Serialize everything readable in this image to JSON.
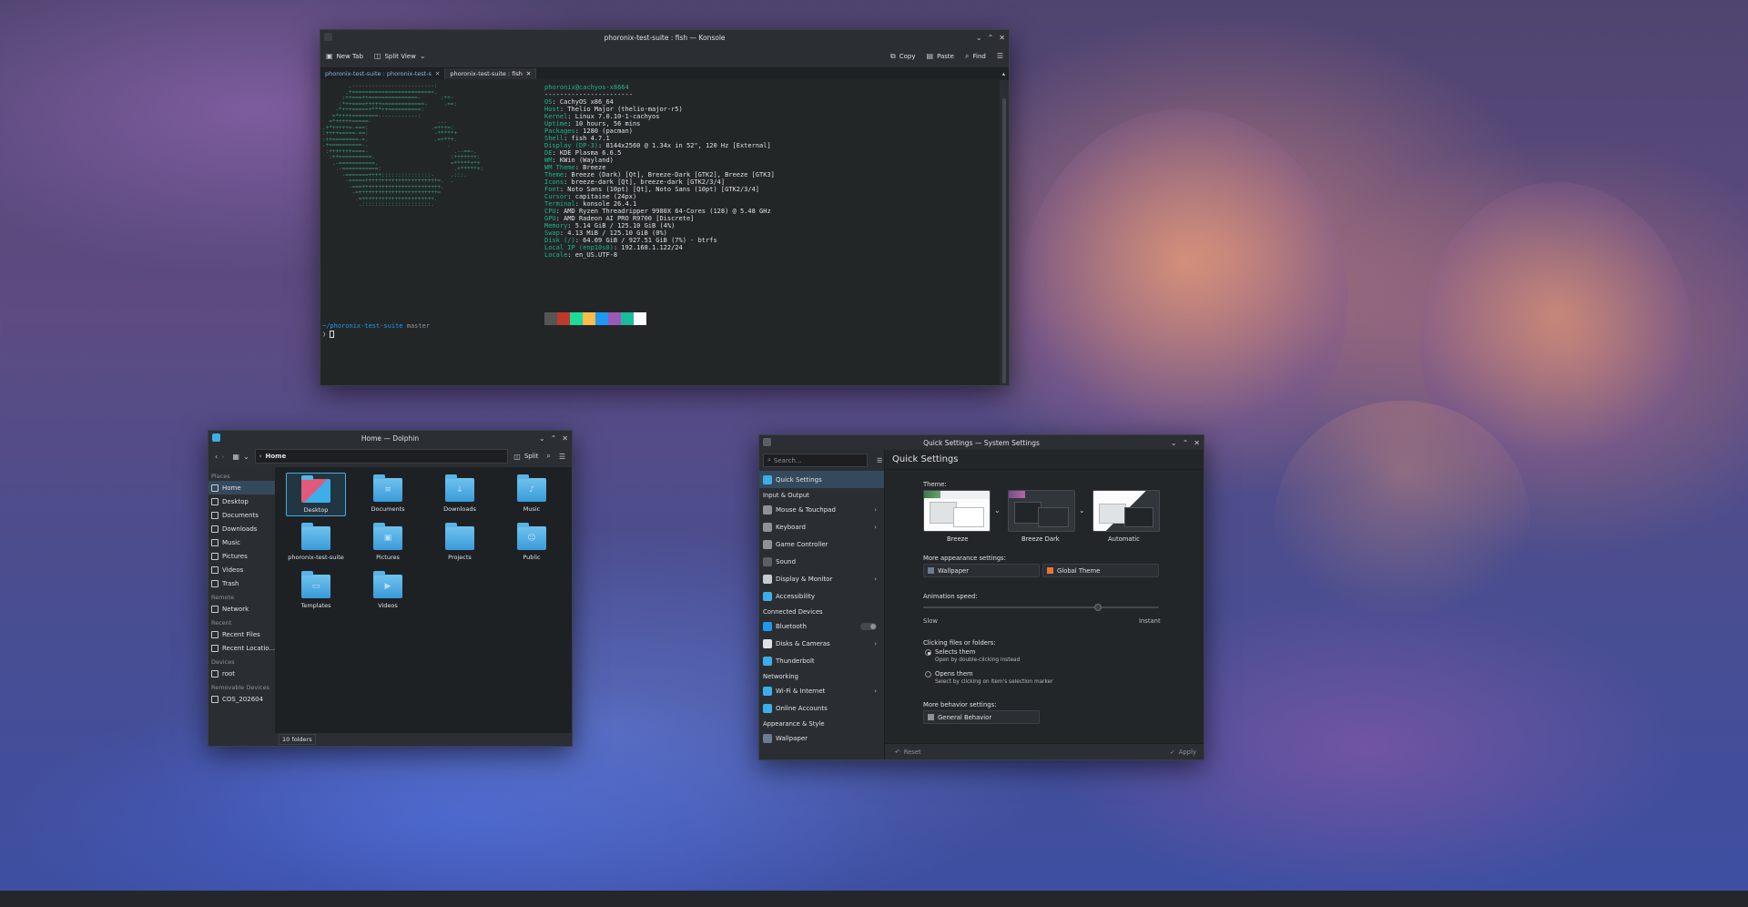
{
  "konsole": {
    "title": "phoronix-test-suite : fish — Konsole",
    "toolbar": {
      "new_tab": "New Tab",
      "split_view": "Split View",
      "copy": "Copy",
      "paste": "Paste",
      "find": "Find"
    },
    "tabs": [
      "phoronix-test-suite : phoronix-test-s",
      "phoronix-test-suite : fish"
    ],
    "user_host": "phoronix@cachyos-x8664",
    "separator": "-----------------------",
    "info": [
      {
        "k": "OS",
        "v": "CachyOS x86_64"
      },
      {
        "k": "Host",
        "v": "Thelio Major (thelio-major-r5)"
      },
      {
        "k": "Kernel",
        "v": "Linux 7.0.10-1-cachyos"
      },
      {
        "k": "Uptime",
        "v": "10 hours, 56 mins"
      },
      {
        "k": "Packages",
        "v": "1280 (pacman)"
      },
      {
        "k": "Shell",
        "v": "fish 4.7.1"
      },
      {
        "k": "Display (DP-3)",
        "v": "8144x2560 @ 1.34x in 52\", 120 Hz [External]"
      },
      {
        "k": "DE",
        "v": "KDE Plasma 6.6.5"
      },
      {
        "k": "WM",
        "v": "KWin (Wayland)"
      },
      {
        "k": "WM Theme",
        "v": "Breeze"
      },
      {
        "k": "Theme",
        "v": "Breeze (Dark) [Qt], Breeze-Dark [GTK2], Breeze [GTK3]"
      },
      {
        "k": "Icons",
        "v": "breeze-dark [Qt], breeze-dark [GTK2/3/4]"
      },
      {
        "k": "Font",
        "v": "Noto Sans (10pt) [Qt], Noto Sans (10pt) [GTK2/3/4]"
      },
      {
        "k": "Cursor",
        "v": "capitaine (24px)"
      },
      {
        "k": "Terminal",
        "v": "konsole 26.4.1"
      },
      {
        "k": "CPU",
        "v": "AMD Ryzen Threadripper 9980X 64-Cores (128) @ 5.48 GHz"
      },
      {
        "k": "GPU",
        "v": "AMD Radeon AI PRO R9700 [Discrete]"
      },
      {
        "k": "Memory",
        "v": "5.14 GiB / 125.10 GiB (4%)"
      },
      {
        "k": "Swap",
        "v": "4.13 MiB / 125.10 GiB (0%)"
      },
      {
        "k": "Disk (/)",
        "v": "64.09 GiB / 927.51 GiB (7%) - btrfs"
      },
      {
        "k": "Local IP (enp10s0)",
        "v": "192.168.1.122/24"
      },
      {
        "k": "Locale",
        "v": "en_US.UTF-8"
      }
    ],
    "prompt_path": "~/phoronix-test-suite",
    "prompt_branch": "master",
    "prompt_symbol": "❯",
    "swatch_colors": [
      "#555555",
      "#c0392b",
      "#1cdc9a",
      "#fdbc4b",
      "#1d99f3",
      "#9b59b6",
      "#1abc9c",
      "#fcfcfc"
    ]
  },
  "dolphin": {
    "title": "Home — Dolphin",
    "breadcrumb": "Home",
    "split_label": "Split",
    "places_header": "Places",
    "places": [
      "Home",
      "Desktop",
      "Documents",
      "Downloads",
      "Music",
      "Pictures",
      "Videos",
      "Trash"
    ],
    "remote_header": "Remote",
    "remote": [
      "Network"
    ],
    "recent_header": "Recent",
    "recent": [
      "Recent Files",
      "Recent Locatio..."
    ],
    "devices_header": "Devices",
    "devices": [
      "root"
    ],
    "removable_header": "Removable Devices",
    "removable": [
      "COS_202604"
    ],
    "files": [
      "Desktop",
      "Documents",
      "Downloads",
      "Music",
      "phoronix-test-suite",
      "Pictures",
      "Projects",
      "Public",
      "Templates",
      "Videos"
    ],
    "status": "10 folders"
  },
  "settings": {
    "title": "Quick Settings — System Settings",
    "search_placeholder": "Search...",
    "page_title": "Quick Settings",
    "sidebar": [
      {
        "type": "item",
        "label": "Quick Settings",
        "selected": true,
        "color": "#3daee9"
      },
      {
        "type": "section",
        "label": "Input & Output"
      },
      {
        "type": "item",
        "label": "Mouse & Touchpad",
        "chevron": true,
        "color": "#8e9297"
      },
      {
        "type": "item",
        "label": "Keyboard",
        "chevron": true,
        "color": "#8e9297"
      },
      {
        "type": "item",
        "label": "Game Controller",
        "color": "#8e9297"
      },
      {
        "type": "item",
        "label": "Sound",
        "color": "#5a5f66"
      },
      {
        "type": "item",
        "label": "Display & Monitor",
        "chevron": true,
        "color": "#c8cacd"
      },
      {
        "type": "item",
        "label": "Accessibility",
        "color": "#3daee9"
      },
      {
        "type": "section",
        "label": "Connected Devices"
      },
      {
        "type": "item",
        "label": "Bluetooth",
        "toggle": true,
        "color": "#1d99f3"
      },
      {
        "type": "item",
        "label": "Disks & Cameras",
        "chevron": true,
        "color": "#dfe1e4"
      },
      {
        "type": "item",
        "label": "Thunderbolt",
        "color": "#3daee9"
      },
      {
        "type": "section",
        "label": "Networking"
      },
      {
        "type": "item",
        "label": "Wi-Fi & Internet",
        "chevron": true,
        "color": "#3daee9"
      },
      {
        "type": "item",
        "label": "Online Accounts",
        "color": "#3daee9"
      },
      {
        "type": "section",
        "label": "Appearance & Style"
      },
      {
        "type": "item",
        "label": "Wallpaper",
        "color": "#6b7c93"
      }
    ],
    "theme_label": "Theme:",
    "themes": [
      "Breeze",
      "Breeze Dark",
      "Automatic"
    ],
    "more_appearance_label": "More appearance settings:",
    "wallpaper_btn": "Wallpaper",
    "global_theme_btn": "Global Theme",
    "animation_label": "Animation speed:",
    "animation_value": 0.75,
    "slow_label": "Slow",
    "instant_label": "Instant",
    "clicking_label": "Clicking files or folders:",
    "opt1": "Selects them",
    "opt1_sub": "Open by double-clicking instead",
    "opt2": "Opens them",
    "opt2_sub": "Select by clicking on item's selection marker",
    "more_behavior_label": "More behavior settings:",
    "general_behavior_btn": "General Behavior",
    "reset_btn": "Reset",
    "apply_btn": "Apply"
  }
}
